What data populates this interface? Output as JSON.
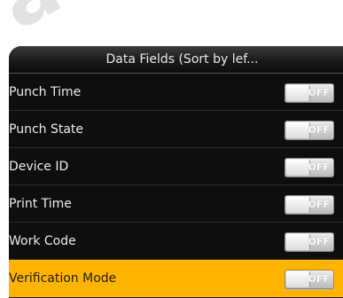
{
  "watermark": "ava",
  "header": {
    "title": "Data Fields (Sort by lef..."
  },
  "rows": [
    {
      "label": "Punch Time",
      "toggle_text": "OFF",
      "state": "off"
    },
    {
      "label": "Punch State",
      "toggle_text": "OFF",
      "state": "off"
    },
    {
      "label": "Device ID",
      "toggle_text": "OFF",
      "state": "off"
    },
    {
      "label": "Print Time",
      "toggle_text": "OFF",
      "state": "off"
    },
    {
      "label": "Work Code",
      "toggle_text": "OFF",
      "state": "off"
    },
    {
      "label": "Verification Mode",
      "toggle_text": "OFF",
      "state": "off",
      "selected": true
    }
  ],
  "colors": {
    "selected_row": "#ffb400",
    "background": "#0e0e0e"
  }
}
